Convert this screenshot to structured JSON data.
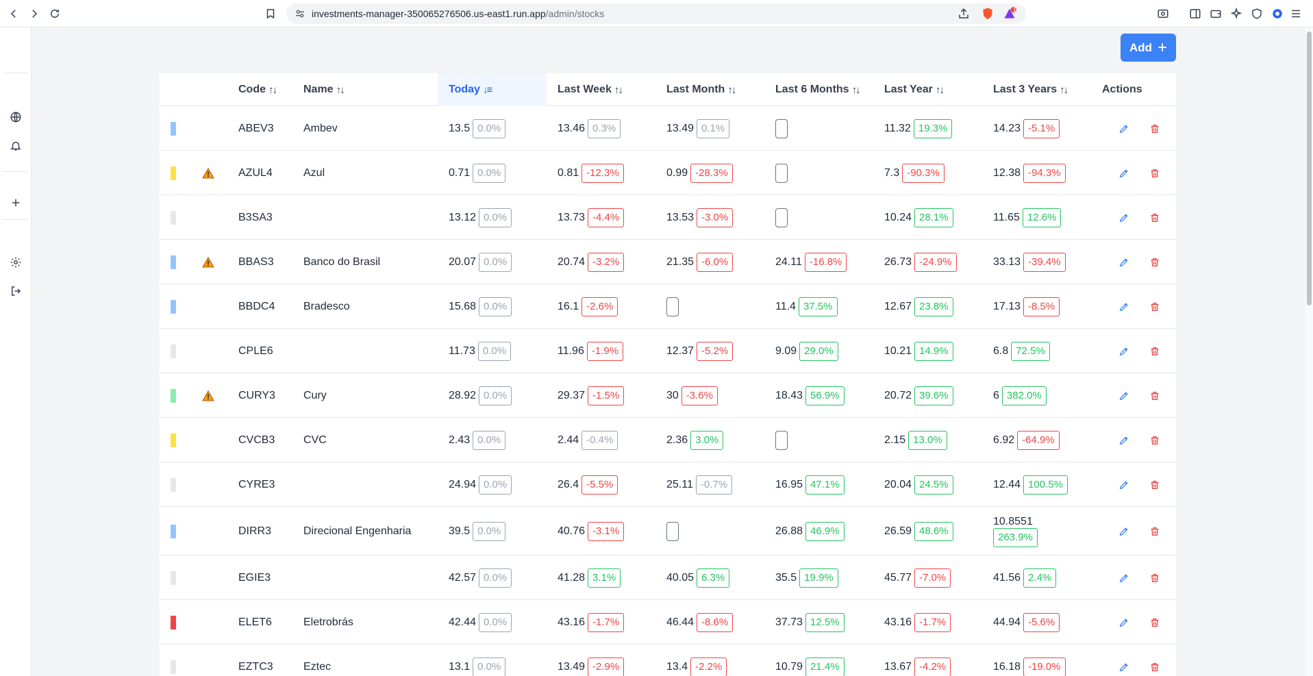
{
  "browser": {
    "url_host": "investments-manager-350065276506.us-east1.run.app",
    "url_path": "/admin/stocks",
    "notification_count": "1"
  },
  "toolbar": {
    "add_label": "Add"
  },
  "table": {
    "headers": {
      "code": "Code",
      "name": "Name",
      "today": "Today",
      "week": "Last Week",
      "month": "Last Month",
      "six": "Last 6 Months",
      "year": "Last Year",
      "three": "Last 3 Years",
      "actions": "Actions"
    },
    "rows": [
      {
        "flag": "#93c5fd",
        "warn": false,
        "code": "ABEV3",
        "name": "Ambev",
        "today": {
          "v": "13.5",
          "p": "0.0%",
          "s": "neu"
        },
        "week": {
          "v": "13.46",
          "p": "0.3%",
          "s": "neu"
        },
        "month": {
          "v": "13.49",
          "p": "0.1%",
          "s": "neu"
        },
        "six": {
          "v": "",
          "p": "",
          "s": "empty"
        },
        "year": {
          "v": "11.32",
          "p": "19.3%",
          "s": "pos"
        },
        "three": {
          "v": "14.23",
          "p": "-5.1%",
          "s": "neg"
        }
      },
      {
        "flag": "#fde047",
        "warn": true,
        "code": "AZUL4",
        "name": "Azul",
        "today": {
          "v": "0.71",
          "p": "0.0%",
          "s": "neu"
        },
        "week": {
          "v": "0.81",
          "p": "-12.3%",
          "s": "neg"
        },
        "month": {
          "v": "0.99",
          "p": "-28.3%",
          "s": "neg"
        },
        "six": {
          "v": "",
          "p": "",
          "s": "empty"
        },
        "year": {
          "v": "7.3",
          "p": "-90.3%",
          "s": "neg"
        },
        "three": {
          "v": "12.38",
          "p": "-94.3%",
          "s": "neg"
        }
      },
      {
        "flag": "#e5e7eb",
        "warn": false,
        "code": "B3SA3",
        "name": "",
        "today": {
          "v": "13.12",
          "p": "0.0%",
          "s": "neu"
        },
        "week": {
          "v": "13.73",
          "p": "-4.4%",
          "s": "neg"
        },
        "month": {
          "v": "13.53",
          "p": "-3.0%",
          "s": "neg"
        },
        "six": {
          "v": "",
          "p": "",
          "s": "empty"
        },
        "year": {
          "v": "10.24",
          "p": "28.1%",
          "s": "pos"
        },
        "three": {
          "v": "11.65",
          "p": "12.6%",
          "s": "pos"
        }
      },
      {
        "flag": "#93c5fd",
        "warn": true,
        "code": "BBAS3",
        "name": "Banco do Brasil",
        "today": {
          "v": "20.07",
          "p": "0.0%",
          "s": "neu"
        },
        "week": {
          "v": "20.74",
          "p": "-3.2%",
          "s": "neg"
        },
        "month": {
          "v": "21.35",
          "p": "-6.0%",
          "s": "neg"
        },
        "six": {
          "v": "24.11",
          "p": "-16.8%",
          "s": "neg"
        },
        "year": {
          "v": "26.73",
          "p": "-24.9%",
          "s": "neg"
        },
        "three": {
          "v": "33.13",
          "p": "-39.4%",
          "s": "neg"
        }
      },
      {
        "flag": "#93c5fd",
        "warn": false,
        "code": "BBDC4",
        "name": "Bradesco",
        "today": {
          "v": "15.68",
          "p": "0.0%",
          "s": "neu"
        },
        "week": {
          "v": "16.1",
          "p": "-2.6%",
          "s": "neg"
        },
        "month": {
          "v": "",
          "p": "",
          "s": "empty"
        },
        "six": {
          "v": "11.4",
          "p": "37.5%",
          "s": "pos"
        },
        "year": {
          "v": "12.67",
          "p": "23.8%",
          "s": "pos"
        },
        "three": {
          "v": "17.13",
          "p": "-8.5%",
          "s": "neg"
        }
      },
      {
        "flag": "#e5e7eb",
        "warn": false,
        "code": "CPLE6",
        "name": "",
        "today": {
          "v": "11.73",
          "p": "0.0%",
          "s": "neu"
        },
        "week": {
          "v": "11.96",
          "p": "-1.9%",
          "s": "neg"
        },
        "month": {
          "v": "12.37",
          "p": "-5.2%",
          "s": "neg"
        },
        "six": {
          "v": "9.09",
          "p": "29.0%",
          "s": "pos"
        },
        "year": {
          "v": "10.21",
          "p": "14.9%",
          "s": "pos"
        },
        "three": {
          "v": "6.8",
          "p": "72.5%",
          "s": "pos"
        }
      },
      {
        "flag": "#86efac",
        "warn": true,
        "code": "CURY3",
        "name": "Cury",
        "today": {
          "v": "28.92",
          "p": "0.0%",
          "s": "neu"
        },
        "week": {
          "v": "29.37",
          "p": "-1.5%",
          "s": "neg"
        },
        "month": {
          "v": "30",
          "p": "-3.6%",
          "s": "neg"
        },
        "six": {
          "v": "18.43",
          "p": "56.9%",
          "s": "pos"
        },
        "year": {
          "v": "20.72",
          "p": "39.6%",
          "s": "pos"
        },
        "three": {
          "v": "6",
          "p": "382.0%",
          "s": "pos"
        }
      },
      {
        "flag": "#fde047",
        "warn": false,
        "code": "CVCB3",
        "name": "CVC",
        "today": {
          "v": "2.43",
          "p": "0.0%",
          "s": "neu"
        },
        "week": {
          "v": "2.44",
          "p": "-0.4%",
          "s": "neu"
        },
        "month": {
          "v": "2.36",
          "p": "3.0%",
          "s": "pos"
        },
        "six": {
          "v": "",
          "p": "",
          "s": "empty"
        },
        "year": {
          "v": "2.15",
          "p": "13.0%",
          "s": "pos"
        },
        "three": {
          "v": "6.92",
          "p": "-64.9%",
          "s": "neg"
        }
      },
      {
        "flag": "#e5e7eb",
        "warn": false,
        "code": "CYRE3",
        "name": "",
        "today": {
          "v": "24.94",
          "p": "0.0%",
          "s": "neu"
        },
        "week": {
          "v": "26.4",
          "p": "-5.5%",
          "s": "neg"
        },
        "month": {
          "v": "25.11",
          "p": "-0.7%",
          "s": "neu"
        },
        "six": {
          "v": "16.95",
          "p": "47.1%",
          "s": "pos"
        },
        "year": {
          "v": "20.04",
          "p": "24.5%",
          "s": "pos"
        },
        "three": {
          "v": "12.44",
          "p": "100.5%",
          "s": "pos"
        }
      },
      {
        "flag": "#93c5fd",
        "warn": false,
        "code": "DIRR3",
        "name": "Direcional Engenharia",
        "today": {
          "v": "39.5",
          "p": "0.0%",
          "s": "neu"
        },
        "week": {
          "v": "40.76",
          "p": "-3.1%",
          "s": "neg"
        },
        "month": {
          "v": "",
          "p": "",
          "s": "empty"
        },
        "six": {
          "v": "26.88",
          "p": "46.9%",
          "s": "pos"
        },
        "year": {
          "v": "26.59",
          "p": "48.6%",
          "s": "pos"
        },
        "three": {
          "v": "10.8551",
          "p": "263.9%",
          "s": "pos",
          "wrap": true
        }
      },
      {
        "flag": "#e5e7eb",
        "warn": false,
        "code": "EGIE3",
        "name": "",
        "today": {
          "v": "42.57",
          "p": "0.0%",
          "s": "neu"
        },
        "week": {
          "v": "41.28",
          "p": "3.1%",
          "s": "pos"
        },
        "month": {
          "v": "40.05",
          "p": "6.3%",
          "s": "pos"
        },
        "six": {
          "v": "35.5",
          "p": "19.9%",
          "s": "pos"
        },
        "year": {
          "v": "45.77",
          "p": "-7.0%",
          "s": "neg"
        },
        "three": {
          "v": "41.56",
          "p": "2.4%",
          "s": "pos"
        }
      },
      {
        "flag": "#ef4444",
        "warn": false,
        "code": "ELET6",
        "name": "Eletrobrás",
        "today": {
          "v": "42.44",
          "p": "0.0%",
          "s": "neu"
        },
        "week": {
          "v": "43.16",
          "p": "-1.7%",
          "s": "neg"
        },
        "month": {
          "v": "46.44",
          "p": "-8.6%",
          "s": "neg"
        },
        "six": {
          "v": "37.73",
          "p": "12.5%",
          "s": "pos"
        },
        "year": {
          "v": "43.16",
          "p": "-1.7%",
          "s": "neg"
        },
        "three": {
          "v": "44.94",
          "p": "-5.6%",
          "s": "neg"
        }
      },
      {
        "flag": "#e5e7eb",
        "warn": false,
        "code": "EZTC3",
        "name": "Eztec",
        "today": {
          "v": "13.1",
          "p": "0.0%",
          "s": "neu"
        },
        "week": {
          "v": "13.49",
          "p": "-2.9%",
          "s": "neg"
        },
        "month": {
          "v": "13.4",
          "p": "-2.2%",
          "s": "neg"
        },
        "six": {
          "v": "10.79",
          "p": "21.4%",
          "s": "pos"
        },
        "year": {
          "v": "13.67",
          "p": "-4.2%",
          "s": "neg"
        },
        "three": {
          "v": "16.18",
          "p": "-19.0%",
          "s": "neg"
        }
      }
    ]
  },
  "colors": {
    "accent": "#3b82f6",
    "positive": "#22c55e",
    "negative": "#ef4444",
    "neutral": "#9ca3af"
  }
}
